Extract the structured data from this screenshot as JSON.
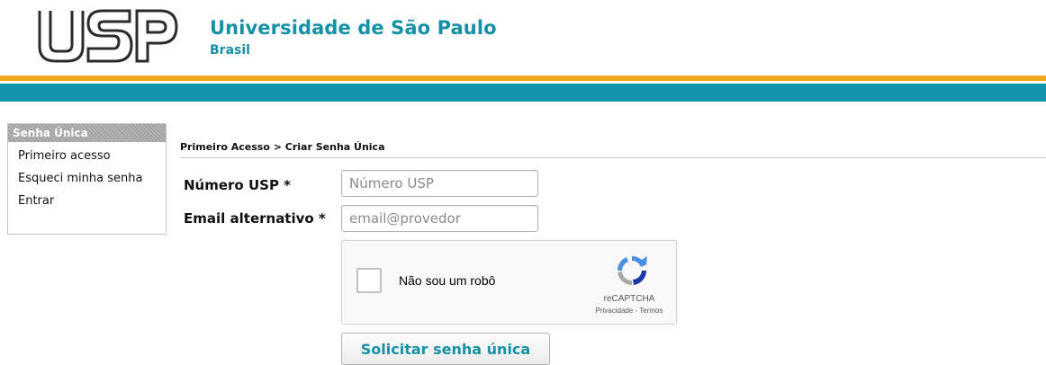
{
  "header": {
    "logo_text": "USP",
    "title": "Universidade de São Paulo",
    "subtitle": "Brasil"
  },
  "colors": {
    "brand_teal": "#1494aa",
    "brand_orange": "#f2a81d",
    "link_teal": "#1591a6"
  },
  "sidebar": {
    "header": "Senha Única",
    "items": [
      {
        "label": "Primeiro acesso"
      },
      {
        "label": "Esqueci minha senha"
      },
      {
        "label": "Entrar"
      }
    ]
  },
  "breadcrumb": "Primeiro Acesso > Criar Senha Única",
  "form": {
    "usp_label": "Número USP *",
    "usp_value": "",
    "usp_placeholder": "Número USP",
    "email_label": "Email alternativo *",
    "email_value": "",
    "email_placeholder": "email@provedor",
    "submit_label": "Solicitar senha única"
  },
  "captcha": {
    "checkbox_label": "Não sou um robô",
    "checked": false,
    "brand": "reCAPTCHA",
    "privacy_link": "Privacidade",
    "separator": " - ",
    "terms_link": "Termos",
    "icon": "recaptcha-logo-icon"
  }
}
